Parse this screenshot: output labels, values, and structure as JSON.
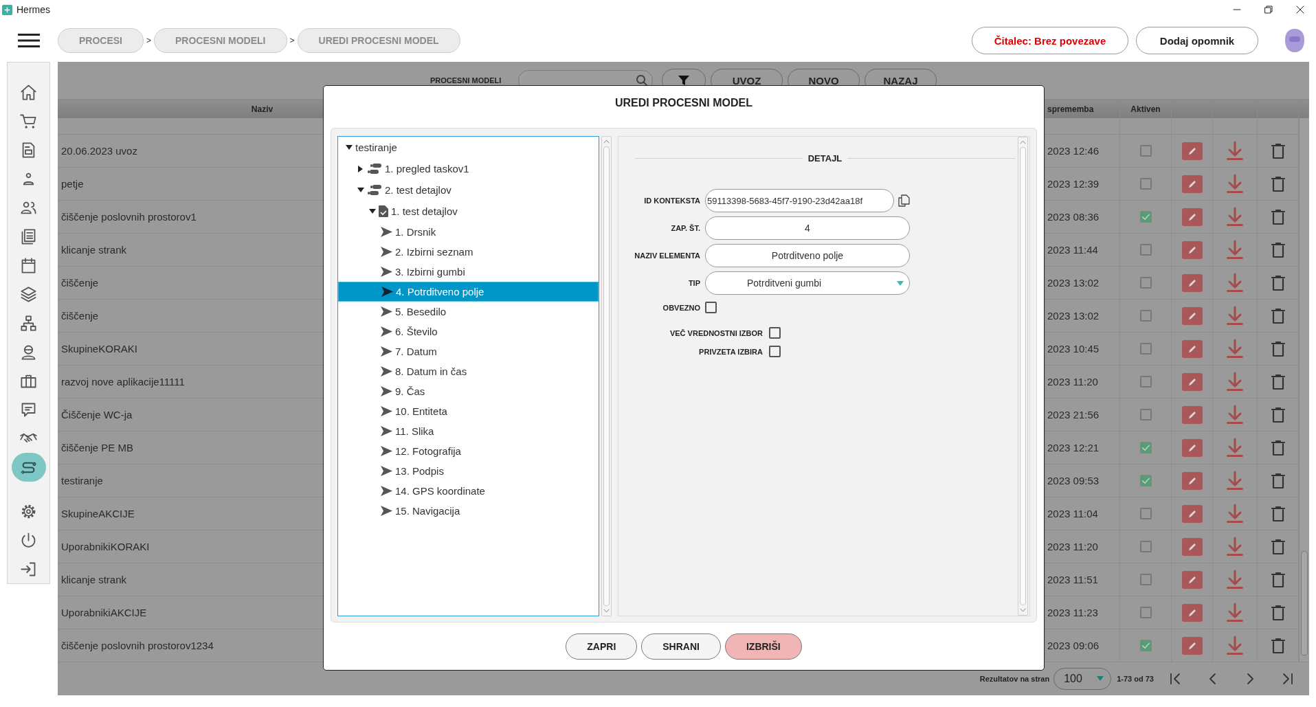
{
  "window": {
    "title": "Hermes"
  },
  "breadcrumbs": [
    {
      "label": "PROCESI"
    },
    {
      "label": "PROCESNI MODELI",
      "separator": ">"
    },
    {
      "label": "UREDI PROCESNI MODEL",
      "separator": ">"
    }
  ],
  "header_buttons": [
    {
      "label": "Čitalec: Brez povezave",
      "kind": "status"
    },
    {
      "label": "Dodaj opomnik",
      "kind": "action"
    }
  ],
  "sidebar": {
    "items": [
      {
        "kind": "home",
        "selected": false
      },
      {
        "kind": "cart",
        "selected": false
      },
      {
        "kind": "document",
        "selected": false
      },
      {
        "kind": "person",
        "selected": false
      },
      {
        "kind": "people",
        "selected": false
      },
      {
        "kind": "news",
        "selected": false
      },
      {
        "kind": "calendar",
        "selected": false
      },
      {
        "kind": "layers",
        "selected": false
      },
      {
        "kind": "network",
        "selected": false
      },
      {
        "kind": "worker",
        "selected": false
      },
      {
        "kind": "briefcase",
        "selected": false
      },
      {
        "kind": "chat",
        "selected": false
      },
      {
        "kind": "handshake",
        "selected": false
      },
      {
        "kind": "flow",
        "selected": true
      },
      {
        "kind": "settings",
        "selected": false
      },
      {
        "kind": "power",
        "selected": false
      },
      {
        "kind": "logout",
        "selected": false
      }
    ]
  },
  "toolbar": {
    "label": "PROCESNI MODELI",
    "buttons": [
      "UVOZ",
      "NOVO",
      "NAZAJ"
    ]
  },
  "table": {
    "columns": [
      {
        "label": "Naziv"
      },
      {
        "label": "sprememba"
      },
      {
        "label": "Aktiven"
      }
    ],
    "rows": [
      {
        "name": "20.06.2023 uvoz",
        "modified": "2023 12:46",
        "active": false
      },
      {
        "name": "petje",
        "modified": "2023 12:39",
        "active": false
      },
      {
        "name": "čiščenje poslovnih prostorov1",
        "modified": "2023 08:36",
        "active": true
      },
      {
        "name": "klicanje strank",
        "modified": "2023 11:44",
        "active": false
      },
      {
        "name": "čiščenje",
        "modified": "2023 13:02",
        "active": false
      },
      {
        "name": "čiščenje",
        "modified": "2023 13:02",
        "active": false
      },
      {
        "name": "SkupineKORAKI",
        "modified": "2023 10:45",
        "active": false
      },
      {
        "name": "razvoj nove aplikacije11111",
        "modified": "2023 11:20",
        "active": false
      },
      {
        "name": "Čiščenje WC-ja",
        "modified": "2023 21:56",
        "active": false
      },
      {
        "name": "čiščenje PE MB",
        "modified": "2023 12:21",
        "active": true
      },
      {
        "name": "testiranje",
        "modified": "2023 09:53",
        "active": true
      },
      {
        "name": "SkupineAKCIJE",
        "modified": "2023 11:04",
        "active": false
      },
      {
        "name": "UporabnikiKORAKI",
        "modified": "2023 11:20",
        "active": false
      },
      {
        "name": "klicanje strank",
        "modified": "2023 11:51",
        "active": false
      },
      {
        "name": "UporabnikiAKCIJE",
        "modified": "2023 11:23",
        "active": false
      },
      {
        "name": "čiščenje poslovnih prostorov1234",
        "modified": "2023 09:06",
        "active": true
      }
    ]
  },
  "pagination": {
    "label": "Rezultatov na stran",
    "page_size": "100",
    "range": "1-73 od 73"
  },
  "dialog": {
    "title": "UREDI PROCESNI MODEL",
    "tree": [
      {
        "label": "testiranje",
        "expanded": true,
        "selected": false,
        "children": [
          {
            "label": "1. pregled taskov1",
            "kind": "step",
            "expanded": false,
            "selected": false
          },
          {
            "label": "2. test detajlov",
            "kind": "step",
            "expanded": true,
            "selected": false,
            "children": [
              {
                "label": "1. test detajlov",
                "kind": "form",
                "expanded": true,
                "selected": false,
                "children": [
                  {
                    "label": "1. Drsnik",
                    "kind": "element",
                    "selected": false
                  },
                  {
                    "label": "2. Izbirni seznam",
                    "kind": "element",
                    "selected": false
                  },
                  {
                    "label": "3. Izbirni gumbi",
                    "kind": "element",
                    "selected": false
                  },
                  {
                    "label": "4. Potrditveno polje",
                    "kind": "element",
                    "selected": true
                  },
                  {
                    "label": "5. Besedilo",
                    "kind": "element",
                    "selected": false
                  },
                  {
                    "label": "6. Število",
                    "kind": "element",
                    "selected": false
                  },
                  {
                    "label": "7. Datum",
                    "kind": "element",
                    "selected": false
                  },
                  {
                    "label": "8. Datum in čas",
                    "kind": "element",
                    "selected": false
                  },
                  {
                    "label": "9. Čas",
                    "kind": "element",
                    "selected": false
                  },
                  {
                    "label": "10. Entiteta",
                    "kind": "element",
                    "selected": false
                  },
                  {
                    "label": "11. Slika",
                    "kind": "element",
                    "selected": false
                  },
                  {
                    "label": "12. Fotografija",
                    "kind": "element",
                    "selected": false
                  },
                  {
                    "label": "13. Podpis",
                    "kind": "element",
                    "selected": false
                  },
                  {
                    "label": "14. GPS koordinate",
                    "kind": "element",
                    "selected": false
                  },
                  {
                    "label": "15. Navigacija",
                    "kind": "element",
                    "selected": false
                  }
                ]
              }
            ]
          }
        ]
      }
    ],
    "detail": {
      "title": "DETAJL",
      "fields": [
        {
          "kind": "text",
          "label": "ID KONTEKSTA",
          "value": "59113398-5683-45f7-9190-23d42aa18f",
          "copyable": true
        },
        {
          "kind": "text",
          "label": "ZAP. ŠT.",
          "value": "4"
        },
        {
          "kind": "text",
          "label": "NAZIV ELEMENTA",
          "value": "Potrditveno polje"
        },
        {
          "kind": "select",
          "label": "TIP",
          "value": "Potrditveni gumbi"
        },
        {
          "kind": "checkbox",
          "label": "OBVEZNO",
          "checked": false
        }
      ],
      "options": [
        {
          "label": "VEČ VREDNOSTNI IZBOR",
          "checked": false
        },
        {
          "label": "PRIVZETA IZBIRA",
          "checked": false
        }
      ]
    },
    "buttons": [
      {
        "label": "ZAPRI",
        "kind": "default"
      },
      {
        "label": "SHRANI",
        "kind": "default"
      },
      {
        "label": "IZBRIŠI",
        "kind": "danger"
      }
    ]
  }
}
